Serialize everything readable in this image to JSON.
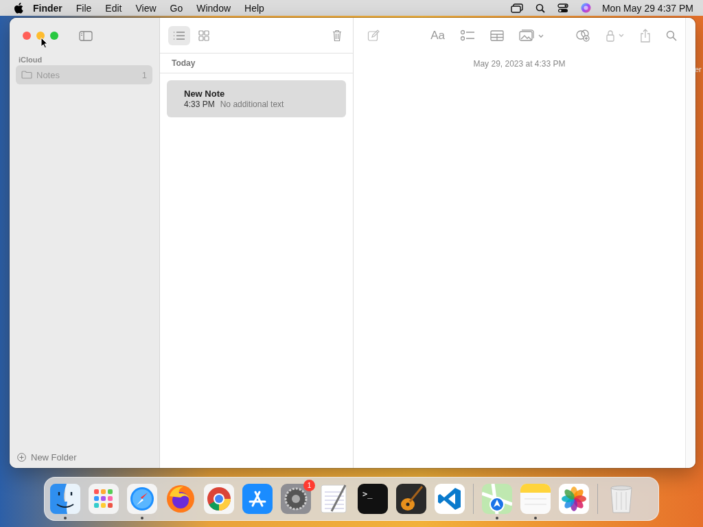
{
  "menu_bar": {
    "app_name": "Finder",
    "menus": [
      "File",
      "Edit",
      "View",
      "Go",
      "Window",
      "Help"
    ],
    "clock": "Mon May 29  4:37 PM"
  },
  "desktop_label": "er",
  "sidebar": {
    "section": "iCloud",
    "folders": [
      {
        "name": "Notes",
        "count": "1",
        "selected": true
      }
    ],
    "new_folder": "New Folder"
  },
  "note_list": {
    "group": "Today",
    "notes": [
      {
        "title": "New Note",
        "time": "4:33 PM",
        "preview": "No additional text",
        "selected": true
      }
    ]
  },
  "editor": {
    "format_glyph": "Aa",
    "date": "May 29, 2023 at 4:33 PM"
  },
  "dock": [
    {
      "kind": "finder",
      "running": true
    },
    {
      "kind": "launchpad",
      "running": false
    },
    {
      "kind": "safari",
      "running": true
    },
    {
      "kind": "firefox",
      "running": false
    },
    {
      "kind": "chrome",
      "running": false
    },
    {
      "kind": "appstore",
      "running": false
    },
    {
      "kind": "settings",
      "running": false,
      "badge": "1"
    },
    {
      "kind": "textedit",
      "running": false
    },
    {
      "kind": "terminal",
      "running": false,
      "glyph": ">_"
    },
    {
      "kind": "garageband",
      "running": false
    },
    {
      "kind": "vscode",
      "running": false
    },
    {
      "kind": "separator"
    },
    {
      "kind": "maps",
      "running": true
    },
    {
      "kind": "notes",
      "running": true
    },
    {
      "kind": "photos",
      "running": false
    },
    {
      "kind": "separator"
    },
    {
      "kind": "trash",
      "running": false
    }
  ]
}
